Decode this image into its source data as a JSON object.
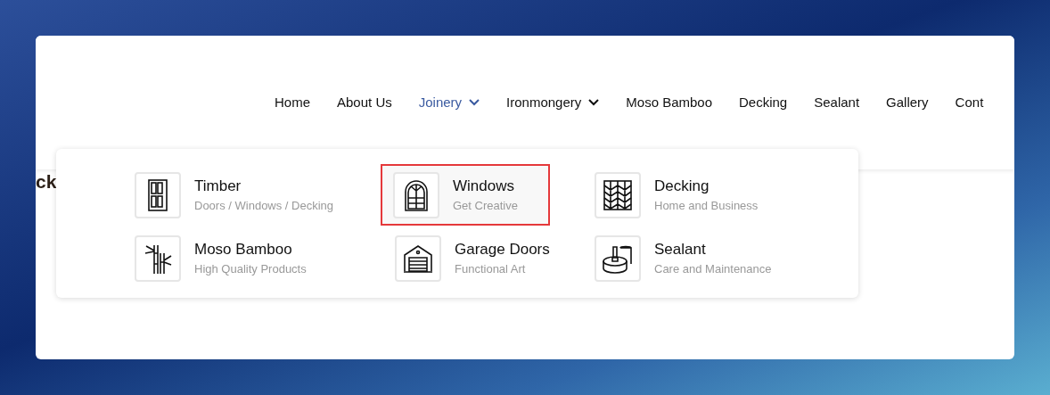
{
  "nav": {
    "items": [
      {
        "label": "Home",
        "selected": false,
        "has_submenu": false
      },
      {
        "label": "About Us",
        "selected": false,
        "has_submenu": false
      },
      {
        "label": "Joinery",
        "selected": true,
        "has_submenu": true
      },
      {
        "label": "Ironmongery",
        "selected": false,
        "has_submenu": true
      },
      {
        "label": "Moso Bamboo",
        "selected": false,
        "has_submenu": false
      },
      {
        "label": "Decking",
        "selected": false,
        "has_submenu": false
      },
      {
        "label": "Sealant",
        "selected": false,
        "has_submenu": false
      },
      {
        "label": "Gallery",
        "selected": false,
        "has_submenu": false
      },
      {
        "label": "Cont",
        "selected": false,
        "has_submenu": false
      }
    ]
  },
  "heading_fragment": "ck",
  "dropdown": {
    "items": [
      {
        "kind": "door",
        "title": "Timber",
        "subtitle": "Doors / Windows / Decking",
        "selected": false
      },
      {
        "kind": "window",
        "title": "Windows",
        "subtitle": "Get Creative",
        "selected": true
      },
      {
        "kind": "decking",
        "title": "Decking",
        "subtitle": "Home and Business",
        "selected": false
      },
      {
        "kind": "bamboo",
        "title": "Moso Bamboo",
        "subtitle": "High Quality Products",
        "selected": false
      },
      {
        "kind": "garage",
        "title": "Garage Doors",
        "subtitle": "Functional Art",
        "selected": false
      },
      {
        "kind": "sealant",
        "title": "Sealant",
        "subtitle": "Care and Maintenance",
        "selected": false
      }
    ]
  }
}
